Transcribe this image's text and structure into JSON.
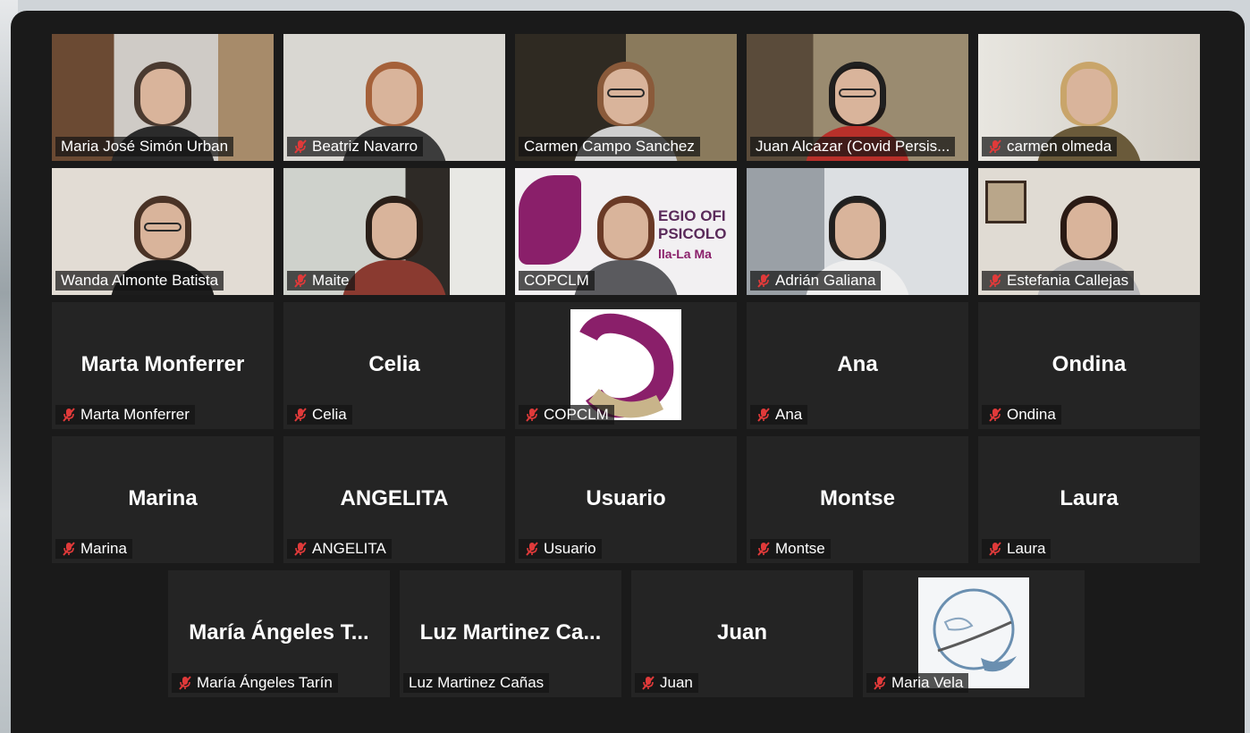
{
  "participants_row1": [
    {
      "name": "Maria José Simón Urban",
      "muted": false
    },
    {
      "name": "Beatriz Navarro",
      "muted": true
    },
    {
      "name": "Carmen Campo Sanchez",
      "muted": false
    },
    {
      "name": "Juan Alcazar (Covid Persis...",
      "muted": false
    },
    {
      "name": "carmen olmeda",
      "muted": true
    }
  ],
  "participants_row2": [
    {
      "name": "Wanda Almonte Batista",
      "muted": false
    },
    {
      "name": "Maite",
      "muted": true
    },
    {
      "name": "COPCLM",
      "muted": false,
      "logo_text_1": "EGIO OFI",
      "logo_text_2": "PSICOLO",
      "logo_text_3": "lla-La Ma"
    },
    {
      "name": "Adrián Galiana",
      "muted": true
    },
    {
      "name": "Estefania Callejas",
      "muted": true
    }
  ],
  "participants_row3": [
    {
      "display": "Marta Monferrer",
      "name": "Marta Monferrer",
      "muted": true
    },
    {
      "display": "Celia",
      "name": "Celia",
      "muted": true
    },
    {
      "display": "",
      "name": "COPCLM",
      "muted": true
    },
    {
      "display": "Ana",
      "name": "Ana",
      "muted": true
    },
    {
      "display": "Ondina",
      "name": "Ondina",
      "muted": true
    }
  ],
  "participants_row4": [
    {
      "display": "Marina",
      "name": "Marina",
      "muted": true
    },
    {
      "display": "ANGELITA",
      "name": "ANGELITA",
      "muted": true
    },
    {
      "display": "Usuario",
      "name": "Usuario",
      "muted": true
    },
    {
      "display": "Montse",
      "name": "Montse",
      "muted": true
    },
    {
      "display": "Laura",
      "name": "Laura",
      "muted": true
    }
  ],
  "participants_row5": [
    {
      "display": "María Ángeles T...",
      "name": "María Ángeles Tarín",
      "muted": true
    },
    {
      "display": "Luz Martinez Ca...",
      "name": "Luz Martinez Cañas",
      "muted": false
    },
    {
      "display": "Juan",
      "name": "Juan",
      "muted": true
    },
    {
      "display": "",
      "name": "Maria Vela",
      "muted": true
    }
  ],
  "colors": {
    "active_speaker": "#d7e84a",
    "mute_red": "#e03a3a",
    "tile_bg": "#242424",
    "window_bg": "#1a1a1a"
  }
}
